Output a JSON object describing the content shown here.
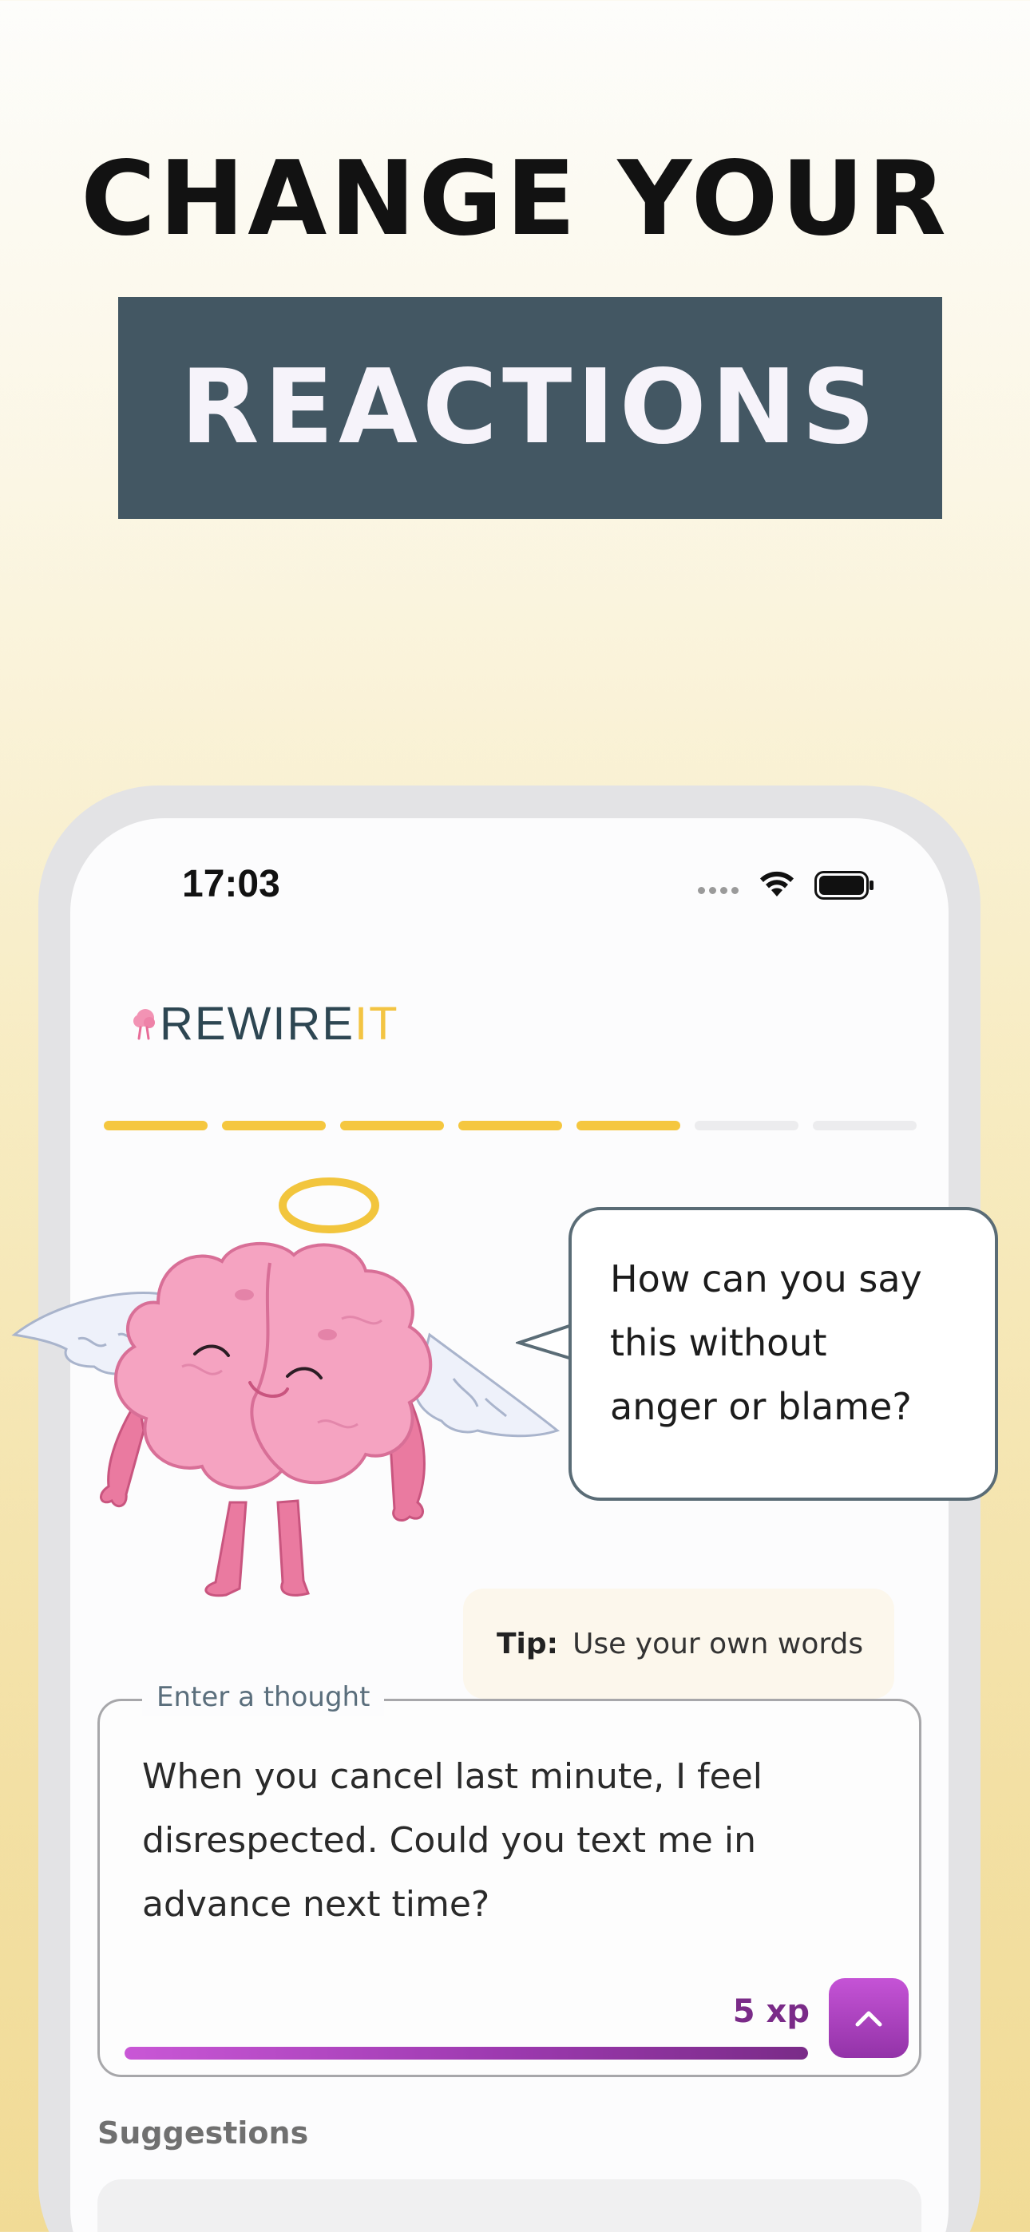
{
  "headline": {
    "line1": "CHANGE YOUR",
    "line2": "REACTIONS"
  },
  "status_bar": {
    "time": "17:03",
    "icons": [
      "signal-icon",
      "wifi-icon",
      "battery-icon"
    ]
  },
  "app": {
    "logo": {
      "prefix": "REWIRE",
      "suffix": "IT",
      "mark_icon": "brain-logo-icon"
    }
  },
  "progress": {
    "total_steps": 7,
    "completed_steps": 5,
    "done_color": "#f5c73f",
    "todo_color": "#ececee"
  },
  "mascot": {
    "icon": "angel-brain-mascot"
  },
  "prompt": {
    "line1": "How can you say",
    "line2": "this without",
    "line3": "anger or blame?"
  },
  "tip": {
    "label": "Tip:",
    "text": "Use your own words"
  },
  "thought_input": {
    "label": "Enter a thought",
    "value": "When you cancel last minute, I feel disrespected. Could you text me in advance next time?",
    "xp_label": "5 xp",
    "xp_progress": 1.0,
    "submit_icon": "chevron-up-icon"
  },
  "suggestions": {
    "heading": "Suggestions"
  },
  "colors": {
    "banner": "#435763",
    "brand_dark": "#2d4652",
    "brand_accent": "#f3c443",
    "xp_purple": "#7a2b88",
    "button_purple": "#b446c8"
  }
}
